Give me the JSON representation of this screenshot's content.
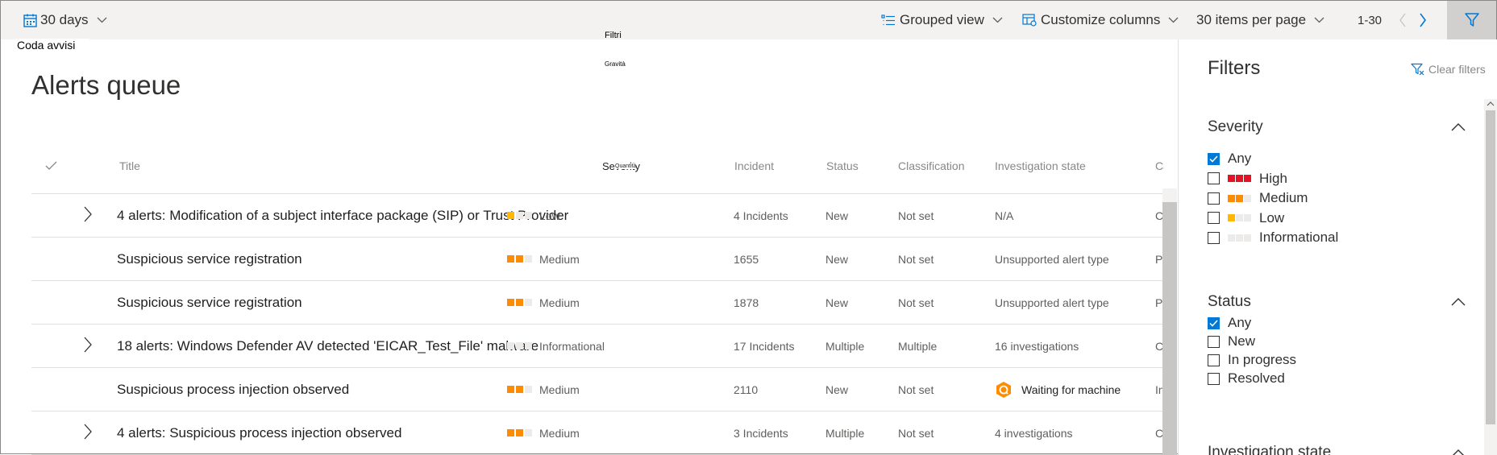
{
  "toolbar": {
    "date_range": "30 days",
    "grouped_view": "Grouped view",
    "customize_columns": "Customize columns",
    "items_per_page": "30 items per page",
    "pager_range": "1-30"
  },
  "overlays": {
    "coda_avvisi": "Coda avvisi",
    "filtri": "Filtri",
    "gravita": "Gravità",
    "quantita": "Quantità"
  },
  "page_title": "Alerts queue",
  "columns": {
    "title": "Title",
    "severity": "Severity",
    "incident": "Incident",
    "status": "Status",
    "classification": "Classification",
    "investigation_state": "Investigation state",
    "category": "Cate"
  },
  "rows": [
    {
      "title": "4 alerts: Modification of a subject interface package (SIP) or Trust Provider",
      "severity": "Low",
      "incident": "4 Incidents",
      "status": "New",
      "classification": "Not set",
      "investigation": "N/A",
      "category": "C"
    },
    {
      "title": "Suspicious service registration",
      "severity": "Medium",
      "incident": "1655",
      "status": "New",
      "classification": "Not set",
      "investigation": "Unsupported alert type",
      "category": "P"
    },
    {
      "title": "Suspicious service registration",
      "severity": "Medium",
      "incident": "1878",
      "status": "New",
      "classification": "Not set",
      "investigation": "Unsupported alert type",
      "category": "P"
    },
    {
      "title": "18 alerts: Windows Defender AV detected 'EICAR_Test_File' malware",
      "severity": "Informational",
      "incident": "17 Incidents",
      "status": "Multiple",
      "classification": "Multiple",
      "investigation": "16 investigations",
      "category": "C"
    },
    {
      "title": "Suspicious process injection observed",
      "severity": "Medium",
      "incident": "2110",
      "status": "New",
      "classification": "Not set",
      "investigation": "Waiting for machine",
      "category": "In"
    },
    {
      "title": "4 alerts: Suspicious process injection observed",
      "severity": "Medium",
      "incident": "3 Incidents",
      "status": "Multiple",
      "classification": "Not set",
      "investigation": "4 investigations",
      "category": "C"
    }
  ],
  "filters": {
    "title": "Filters",
    "clear": "Clear filters",
    "severity": {
      "title": "Severity",
      "options": [
        "Any",
        "High",
        "Medium",
        "Low",
        "Informational"
      ]
    },
    "status": {
      "title": "Status",
      "options": [
        "Any",
        "New",
        "In progress",
        "Resolved"
      ]
    },
    "next_section": "Investigation state"
  },
  "colors": {
    "high": "#e81123",
    "medium": "#ff8c00",
    "low": "#ffb900",
    "empty": "#edebe9",
    "accent": "#0078d4"
  }
}
